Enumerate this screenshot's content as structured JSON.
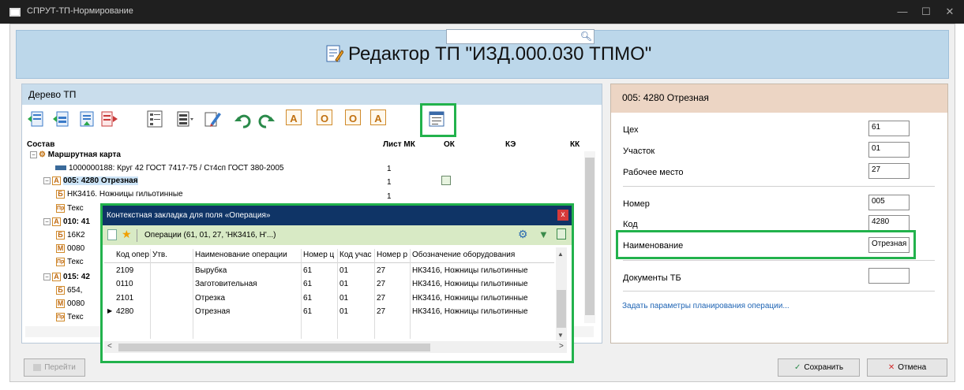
{
  "window": {
    "title": "СПРУТ-ТП-Нормирование"
  },
  "banner": {
    "title": "Редактор ТП \"ИЗД.000.030 ТПМО\""
  },
  "tree_panel": {
    "header": "Дерево ТП",
    "columns": [
      "Состав",
      "Лист МК",
      "ОК",
      "КЭ",
      "КК"
    ],
    "rows": [
      {
        "text": "Маршрутная карта",
        "sheet": ""
      },
      {
        "text": "1000000188: Круг 42 ГОСТ 7417-75 / Ст4сп ГОСТ 380-2005",
        "sheet": "1"
      },
      {
        "badge": "А",
        "text": "005: 4280 Отрезная",
        "sheet": "1"
      },
      {
        "badge": "Б",
        "text": "НК3416. Ножницы гильотинные",
        "sheet": "1"
      },
      {
        "badge": "Пр",
        "text": "Текс",
        "sheet": ""
      },
      {
        "badge": "А",
        "text": "010: 41",
        "sheet": ""
      },
      {
        "badge": "Б",
        "text": "16К2",
        "sheet": ""
      },
      {
        "badge": "М",
        "text": "0080",
        "sheet": ""
      },
      {
        "badge": "Пр",
        "text": "Текс",
        "sheet": ""
      },
      {
        "badge": "А",
        "text": "015: 42",
        "sheet": ""
      },
      {
        "badge": "Б",
        "text": "654,",
        "sheet": ""
      },
      {
        "badge": "М",
        "text": "0080",
        "sheet": ""
      },
      {
        "badge": "Пр",
        "text": "Текс",
        "sheet": ""
      }
    ]
  },
  "props_panel": {
    "header": "005: 4280 Отрезная",
    "fields": [
      {
        "label": "Цех",
        "value": "61"
      },
      {
        "label": "Участок",
        "value": "01"
      },
      {
        "label": "Рабочее место",
        "value": "27"
      },
      {
        "label": "Номер",
        "value": "005"
      },
      {
        "label": "Код",
        "value": "4280"
      },
      {
        "label": "Наименование",
        "value": "Отрезная"
      },
      {
        "label": "Документы ТБ",
        "value": ""
      }
    ],
    "link": "Задать параметры планирования операции..."
  },
  "popup": {
    "title": "Контекстная закладка для поля «Операция»",
    "toolbar_text": "Операции (61, 01, 27, 'НК3416, Н'...)",
    "close": "x",
    "columns": [
      "Код опер",
      "Утв.",
      "Наименование операции",
      "Номер ц",
      "Код учас",
      "Номер р",
      "Обозначение оборудования"
    ],
    "rows": [
      [
        "2109",
        "",
        "Вырубка",
        "61",
        "01",
        "27",
        "НК3416, Ножницы гильотинные"
      ],
      [
        "0110",
        "",
        "Заготовительная",
        "61",
        "01",
        "27",
        "НК3416, Ножницы гильотинные"
      ],
      [
        "2101",
        "",
        "Отрезка",
        "61",
        "01",
        "27",
        "НК3416, Ножницы гильотинные"
      ],
      [
        "4280",
        "",
        "Отрезная",
        "61",
        "01",
        "27",
        "НК3416, Ножницы гильотинные"
      ]
    ]
  },
  "buttons": {
    "go": "Перейти",
    "save": "Сохранить",
    "cancel": "Отмена"
  },
  "colors": {
    "highlight": "#22b24c",
    "banner": "#bcd7ea",
    "props_header": "#ecd5c4",
    "popup_title": "#0f3466"
  }
}
